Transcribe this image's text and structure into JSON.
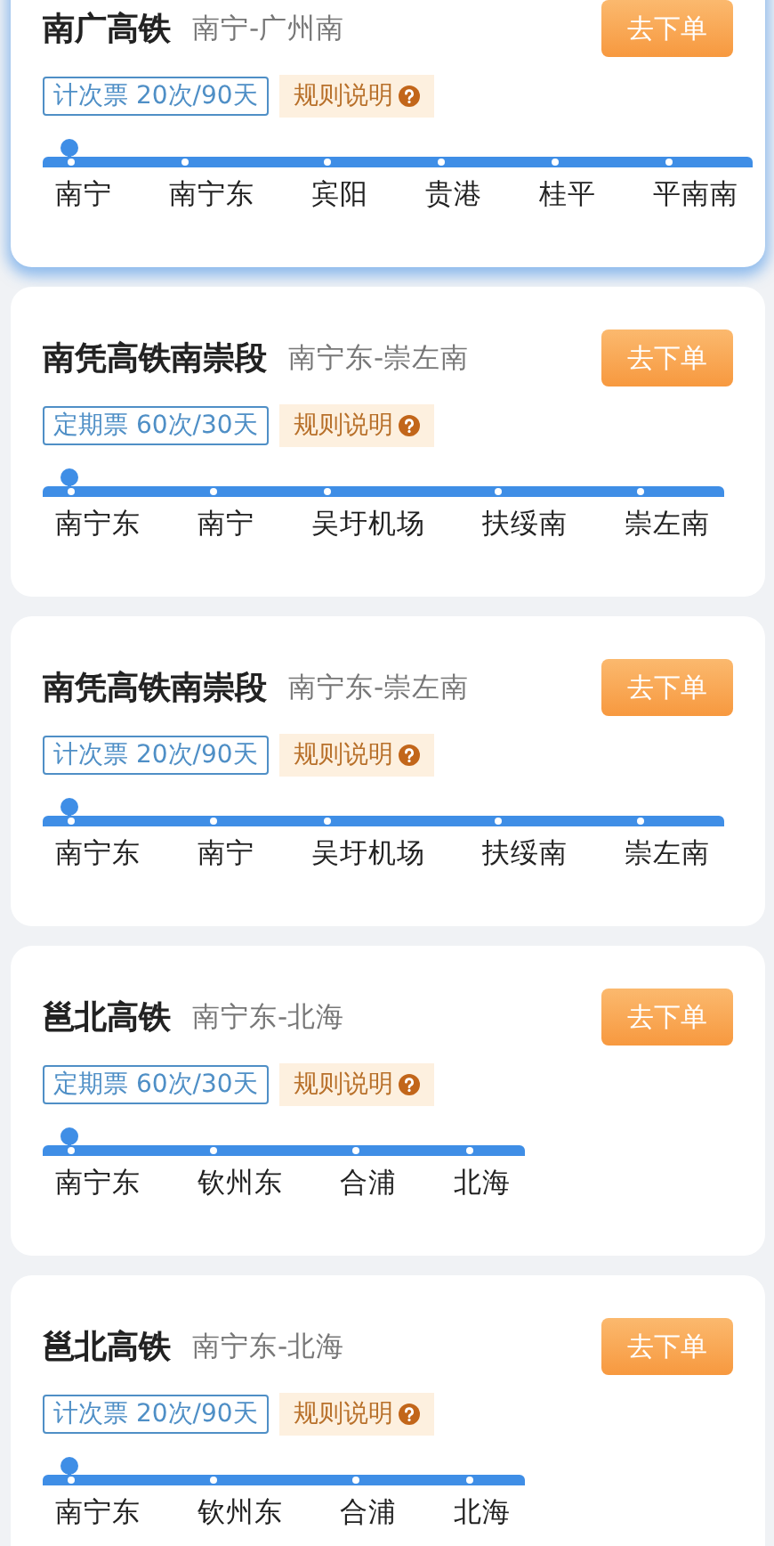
{
  "cards": [
    {
      "selected": true,
      "name": "南广高铁",
      "route": "南宁-广州南",
      "ticket": "计次票 20次/90天",
      "rules": "规则说明",
      "button": "去下单",
      "stations": [
        "南宁",
        "南宁东",
        "宾阳",
        "贵港",
        "桂平",
        "平南南"
      ]
    },
    {
      "selected": false,
      "name": "南凭高铁南崇段",
      "route": "南宁东-崇左南",
      "ticket": "定期票 60次/30天",
      "rules": "规则说明",
      "button": "去下单",
      "stations": [
        "南宁东",
        "南宁",
        "吴圩机场",
        "扶绥南",
        "崇左南"
      ]
    },
    {
      "selected": false,
      "name": "南凭高铁南崇段",
      "route": "南宁东-崇左南",
      "ticket": "计次票 20次/90天",
      "rules": "规则说明",
      "button": "去下单",
      "stations": [
        "南宁东",
        "南宁",
        "吴圩机场",
        "扶绥南",
        "崇左南"
      ]
    },
    {
      "selected": false,
      "name": "邕北高铁",
      "route": "南宁东-北海",
      "ticket": "定期票 60次/30天",
      "rules": "规则说明",
      "button": "去下单",
      "stations": [
        "南宁东",
        "钦州东",
        "合浦",
        "北海"
      ]
    },
    {
      "selected": false,
      "name": "邕北高铁",
      "route": "南宁东-北海",
      "ticket": "计次票 20次/90天",
      "rules": "规则说明",
      "button": "去下单",
      "stations": [
        "南宁东",
        "钦州东",
        "合浦",
        "北海"
      ]
    }
  ]
}
